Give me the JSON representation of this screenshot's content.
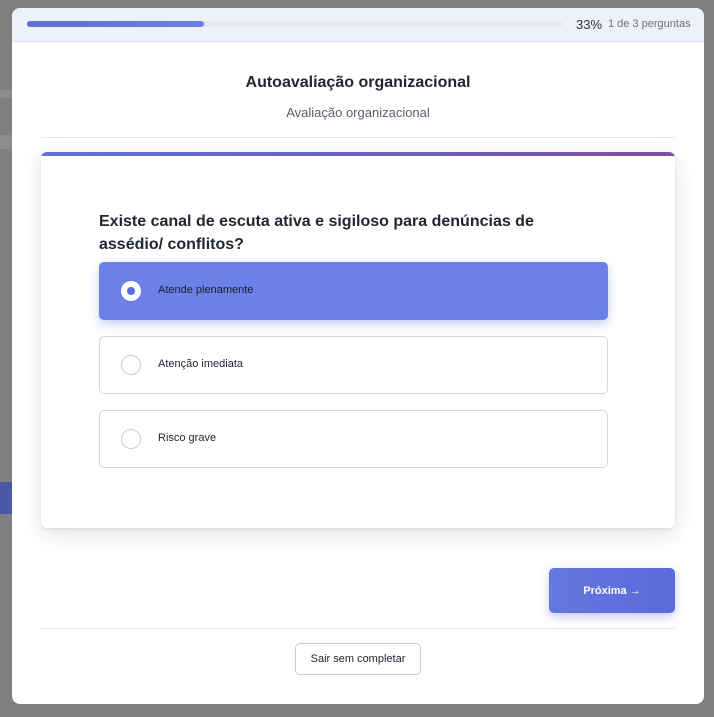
{
  "progress": {
    "percent_label": "33%",
    "fraction": 0.33,
    "count_label": "1 de 3 perguntas"
  },
  "header": {
    "title": "Autoavaliação organizacional",
    "subtitle": "Avaliação organizacional"
  },
  "question": {
    "text": "Existe canal de escuta ativa e sigiloso para denúncias de assédio/ conflitos?",
    "options": [
      {
        "label": "Atende plenamente",
        "selected": true
      },
      {
        "label": "Atenção imediata",
        "selected": false
      },
      {
        "label": "Risco grave",
        "selected": false
      }
    ]
  },
  "actions": {
    "next_label": "Próxima →",
    "exit_label": "Sair sem completar"
  },
  "colors": {
    "accent": "#6b80e8",
    "progress": "#5b6fd8"
  }
}
